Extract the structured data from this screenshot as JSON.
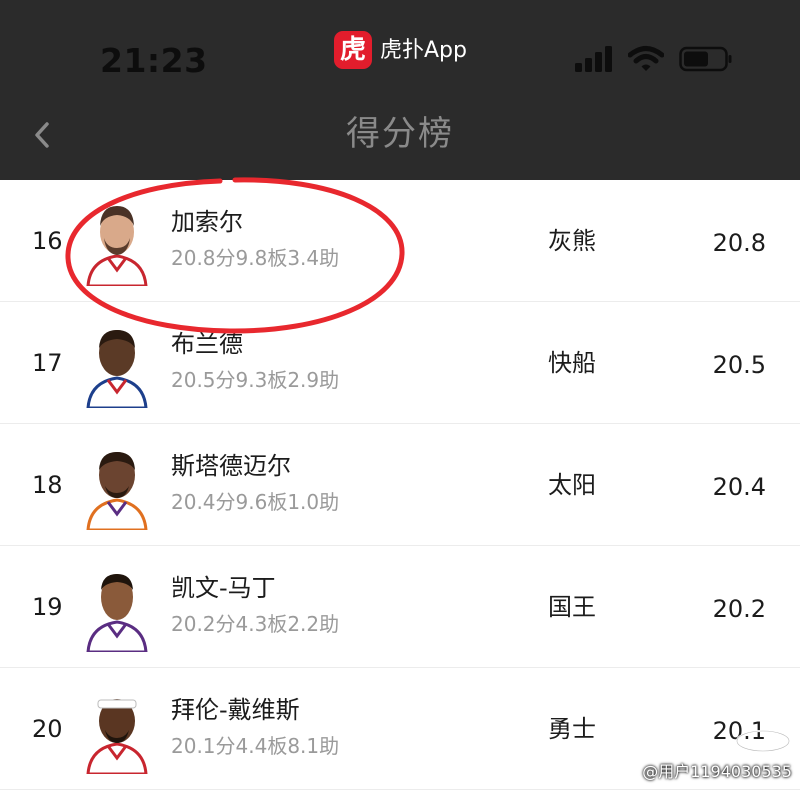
{
  "status_bar": {
    "time": "21:23",
    "app_badge": "虎",
    "app_name": "虎扑App"
  },
  "nav": {
    "title": "得分榜"
  },
  "rows": [
    {
      "rank": "16",
      "name": "加索尔",
      "stats": "20.8分9.8板3.4助",
      "team": "灰熊",
      "score": "20.8",
      "jersey_color": "#c8262f"
    },
    {
      "rank": "17",
      "name": "布兰德",
      "stats": "20.5分9.3板2.9助",
      "team": "快船",
      "score": "20.5",
      "jersey_color": "#1d3f8c"
    },
    {
      "rank": "18",
      "name": "斯塔德迈尔",
      "stats": "20.4分9.6板1.0助",
      "team": "太阳",
      "score": "20.4",
      "jersey_color": "#e07020"
    },
    {
      "rank": "19",
      "name": "凯文-马丁",
      "stats": "20.2分4.3板2.2助",
      "team": "国王",
      "score": "20.2",
      "jersey_color": "#5a2d82"
    },
    {
      "rank": "20",
      "name": "拜伦-戴维斯",
      "stats": "20.1分4.4板8.1助",
      "team": "勇士",
      "score": "20.1",
      "jersey_color": "#1d4fa0"
    }
  ],
  "watermark": "@用户1194030535",
  "colors": {
    "header_bg": "#2b2b2b",
    "app_badge": "#e21d2c",
    "highlight_circle": "#e8282e"
  },
  "icons": {
    "back": "chevron-left-icon",
    "signal": "cellular-signal-icon",
    "wifi": "wifi-icon",
    "battery": "battery-icon"
  }
}
